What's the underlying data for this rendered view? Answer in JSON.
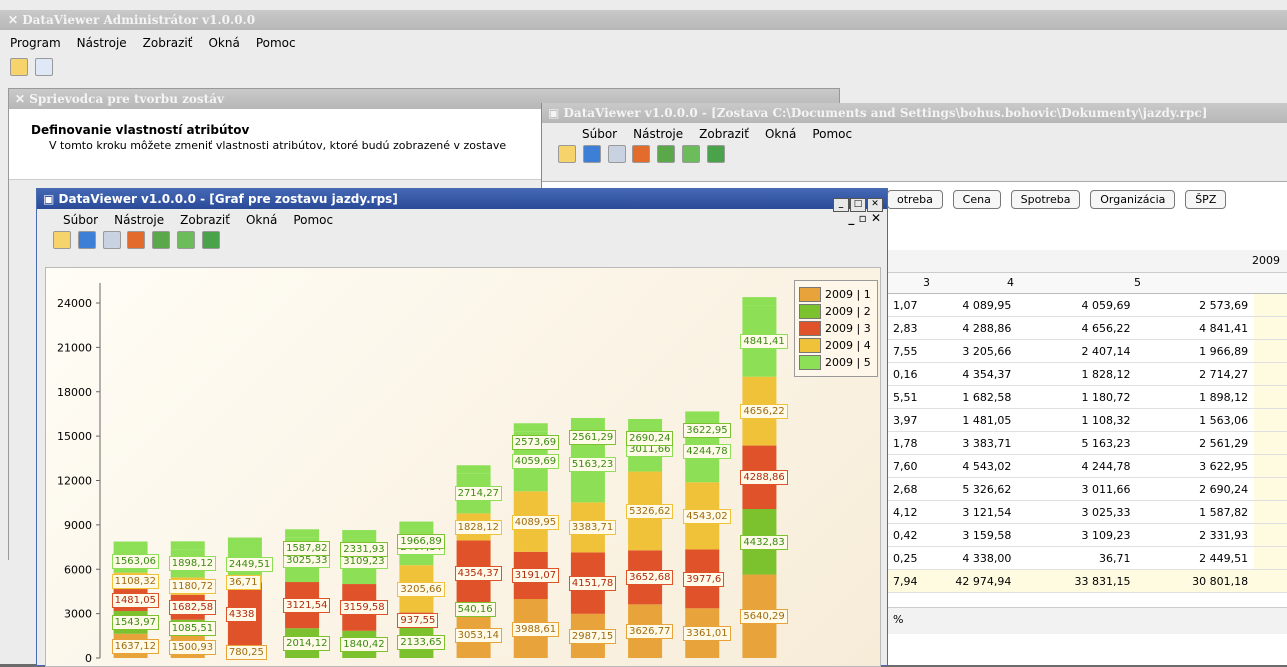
{
  "admin": {
    "title": "DataViewer Administrátor v1.0.0.0",
    "menu": [
      "Program",
      "Nástroje",
      "Zobraziť",
      "Okná",
      "Pomoc"
    ]
  },
  "wizard": {
    "title": "Sprievodca pre tvorbu zostáv",
    "heading": "Definovanie vlastností atribútov",
    "description": "V tomto kroku môžete zmeniť vlastnosti atribútov, ktoré budú zobrazené v zostave"
  },
  "report": {
    "title": "DataViewer v1.0.0.0 - [Zostava C:\\Documents and Settings\\bohus.bohovic\\Dokumenty\\jazdy.rpc]",
    "menu": [
      "Súbor",
      "Nástroje",
      "Zobraziť",
      "Okná",
      "Pomoc"
    ],
    "columns": [
      "otreba",
      "Cena",
      "Spotreba",
      "Organizácia",
      "ŠPZ"
    ],
    "year_header": "2009",
    "col_headers": [
      "3",
      "4",
      "5"
    ],
    "rows": [
      [
        "1,07",
        "4 089,95",
        "4 059,69",
        "2 573,69"
      ],
      [
        "2,83",
        "4 288,86",
        "4 656,22",
        "4 841,41"
      ],
      [
        "7,55",
        "3 205,66",
        "2 407,14",
        "1 966,89"
      ],
      [
        "0,16",
        "4 354,37",
        "1 828,12",
        "2 714,27"
      ],
      [
        "5,51",
        "1 682,58",
        "1 180,72",
        "1 898,12"
      ],
      [
        "3,97",
        "1 481,05",
        "1 108,32",
        "1 563,06"
      ],
      [
        "1,78",
        "3 383,71",
        "5 163,23",
        "2 561,29"
      ],
      [
        "7,60",
        "4 543,02",
        "4 244,78",
        "3 622,95"
      ],
      [
        "2,68",
        "5 326,62",
        "3 011,66",
        "2 690,24"
      ],
      [
        "4,12",
        "3 121,54",
        "3 025,33",
        "1 587,82"
      ],
      [
        "0,42",
        "3 159,58",
        "3 109,23",
        "2 331,93"
      ],
      [
        "0,25",
        "4 338,00",
        "36,71",
        "2 449,51"
      ]
    ],
    "total_row": [
      "7,94",
      "42 974,94",
      "33 831,15",
      "30 801,18"
    ],
    "footer_text": "%"
  },
  "chart_window": {
    "title": "DataViewer v1.0.0.0 - [Graf pre zostavu jazdy.rps]",
    "menu": [
      "Súbor",
      "Nástroje",
      "Zobraziť",
      "Okná",
      "Pomoc"
    ]
  },
  "colors": {
    "s1": "#e8a33a",
    "s2": "#7cc12e",
    "s3": "#e0532a",
    "s4": "#f0c23a",
    "s5": "#8de056"
  },
  "chart_data": {
    "type": "bar",
    "stacked": true,
    "ylim": [
      0,
      24000
    ],
    "yticks": [
      "0",
      "3000",
      "6000",
      "9000",
      "12000",
      "15000",
      "18000",
      "21000",
      "24000"
    ],
    "legend_position": "top-right",
    "series": [
      {
        "name": "2009 | 1",
        "values": [
          1637.12,
          1500.93,
          780.25,
          null,
          null,
          null,
          3053.14,
          3988.61,
          2987.15,
          3626.77,
          3361.01,
          5640.29
        ]
      },
      {
        "name": "2009 | 2",
        "values": [
          1543.97,
          1085.51,
          null,
          2014.12,
          1840.42,
          2133.65,
          540.16,
          null,
          null,
          null,
          null,
          4432.83
        ]
      },
      {
        "name": "2009 | 3",
        "values": [
          1481.05,
          1682.58,
          4338,
          3121.54,
          3159.58,
          937.55,
          4354.37,
          3191.07,
          4151.78,
          3652.68,
          3977.6,
          4288.86
        ]
      },
      {
        "name": "2009 | 4",
        "values": [
          1108.32,
          1180.72,
          36.71,
          null,
          null,
          3205.66,
          1828.12,
          4089.95,
          3383.71,
          5326.62,
          4543.02,
          4656.22
        ]
      },
      {
        "name": "2009 | 5",
        "values": [
          1563.06,
          1898.12,
          2449.51,
          3025.33,
          3109.23,
          2407.14,
          2714.27,
          4059.69,
          5163.23,
          3011.66,
          4244.78,
          4841.41
        ]
      }
    ],
    "top_labels": [
      "",
      "",
      "",
      "1587,82",
      "2331,93",
      "1966,89",
      "",
      "2573,69",
      "2561,29",
      "2690,24",
      "3622,95",
      ""
    ]
  }
}
